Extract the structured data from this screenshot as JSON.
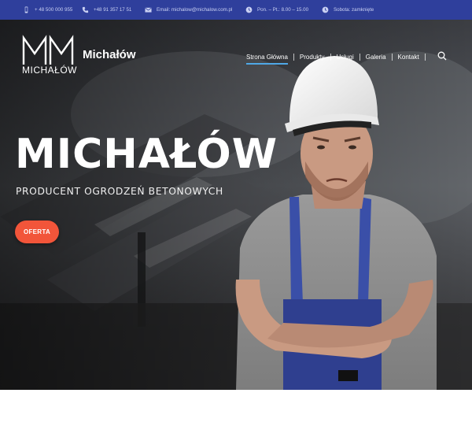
{
  "topbar": {
    "items": [
      {
        "icon": "mobile-phone-icon",
        "text": "+ 48 500 000 955"
      },
      {
        "icon": "phone-icon",
        "text": "+48 91 357 17 51"
      },
      {
        "icon": "envelope-icon",
        "text": "Email: michalow@michalow.com.pl"
      },
      {
        "icon": "clock-icon",
        "text": "Pon. – Pt.: 8.00 – 15.00"
      },
      {
        "icon": "clock-icon",
        "text": "Sobota: zamknięte"
      }
    ],
    "background": "#2f3f9c"
  },
  "header": {
    "logo_text": "MICHAŁÓW",
    "brand": "Michałów",
    "nav": [
      {
        "label": "Strona Główna",
        "active": true
      },
      {
        "label": "Produkty"
      },
      {
        "label": "Usługi"
      },
      {
        "label": "Galeria"
      },
      {
        "label": "Kontakt"
      }
    ],
    "search_icon": "search-icon"
  },
  "hero": {
    "title": "MICHAŁÓW",
    "subtitle": "PRODUCENT OGRODZEŃ BETONOWYCH",
    "cta_label": "OFERTA",
    "cta_color": "#f2553a",
    "accent": "#4fa8e6"
  }
}
